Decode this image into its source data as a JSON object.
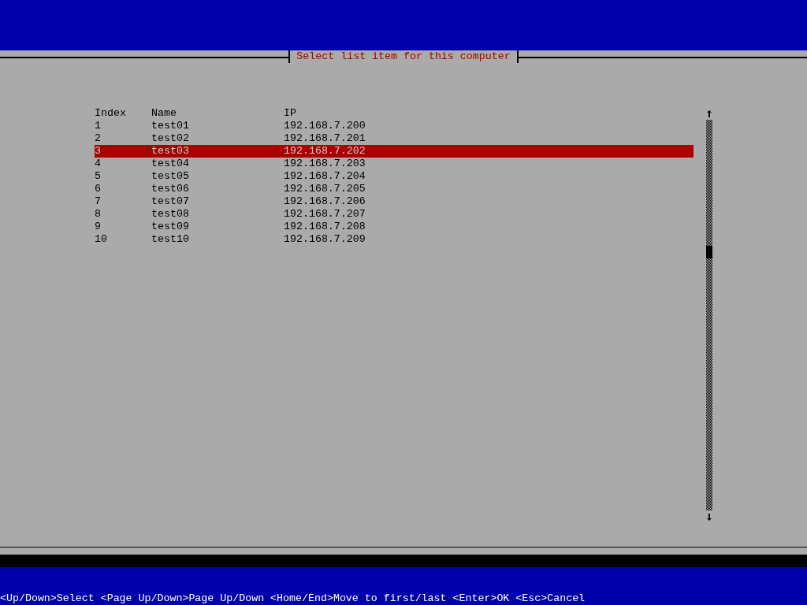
{
  "dialog": {
    "title": "Select list item for this computer"
  },
  "table": {
    "columns": [
      "Index",
      "Name",
      "IP"
    ],
    "rows": [
      {
        "cells": [
          "1",
          "test01",
          "192.168.7.200"
        ],
        "selected": false
      },
      {
        "cells": [
          "2",
          "test02",
          "192.168.7.201"
        ],
        "selected": false
      },
      {
        "cells": [
          "3",
          "test03",
          "192.168.7.202"
        ],
        "selected": true
      },
      {
        "cells": [
          "4",
          "test04",
          "192.168.7.203"
        ],
        "selected": false
      },
      {
        "cells": [
          "5",
          "test05",
          "192.168.7.204"
        ],
        "selected": false
      },
      {
        "cells": [
          "6",
          "test06",
          "192.168.7.205"
        ],
        "selected": false
      },
      {
        "cells": [
          "7",
          "test07",
          "192.168.7.206"
        ],
        "selected": false
      },
      {
        "cells": [
          "8",
          "test08",
          "192.168.7.207"
        ],
        "selected": false
      },
      {
        "cells": [
          "9",
          "test09",
          "192.168.7.208"
        ],
        "selected": false
      },
      {
        "cells": [
          "10",
          "test10",
          "192.168.7.209"
        ],
        "selected": false
      }
    ]
  },
  "status_bar": {
    "text": "<Up/Down>Select <Page Up/Down>Page Up/Down <Home/End>Move to first/last <Enter>OK <Esc>Cancel"
  }
}
